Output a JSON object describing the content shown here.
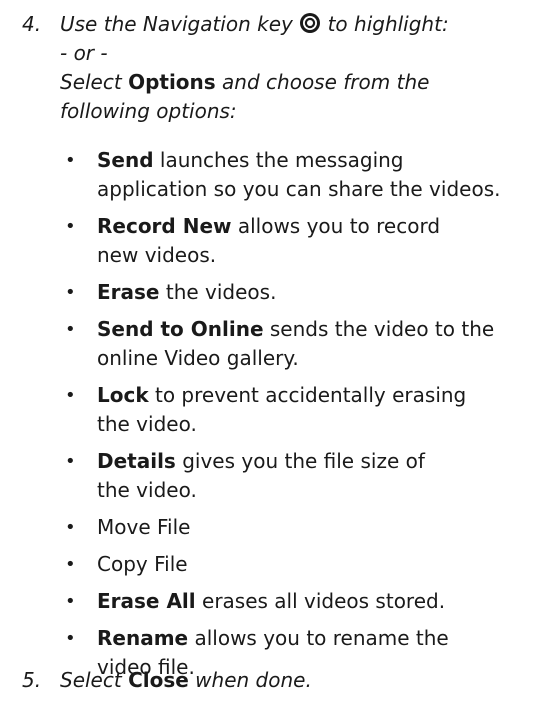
{
  "step4": {
    "number": "4.",
    "line1_before": "Use the Navigation key",
    "line1_after": "to highlight:",
    "line2": "- or -",
    "line3_pre": "Select",
    "line3_bold": "Options",
    "line3_post": "and choose from the",
    "line4": "following options:"
  },
  "icons": {
    "navigation_key": "navigation-key-icon"
  },
  "options": [
    {
      "bold": "Send",
      "text_lines": [
        " launches the messaging",
        "application so you can share the videos."
      ]
    },
    {
      "bold": "Record New",
      "text_lines": [
        " allows you to record",
        "new videos."
      ]
    },
    {
      "bold": "Erase",
      "text_lines": [
        " the videos."
      ]
    },
    {
      "bold": "Send to Online",
      "text_lines": [
        " sends the video to the",
        "online Video gallery."
      ]
    },
    {
      "bold": "Lock",
      "text_lines": [
        " to prevent accidentally erasing",
        "the video."
      ]
    },
    {
      "bold": "Details",
      "text_lines": [
        " gives you the file size of",
        "the video."
      ]
    },
    {
      "bold": "",
      "text_lines": [
        "Move File"
      ]
    },
    {
      "bold": "",
      "text_lines": [
        "Copy File"
      ]
    },
    {
      "bold": "Erase All",
      "text_lines": [
        " erases all videos stored."
      ]
    },
    {
      "bold": "Rename",
      "text_lines": [
        " allows you to rename the",
        "video file."
      ]
    }
  ],
  "bullet": "•",
  "step5": {
    "number": "5.",
    "pre": "Select",
    "bold": "Close",
    "post": "when done."
  }
}
